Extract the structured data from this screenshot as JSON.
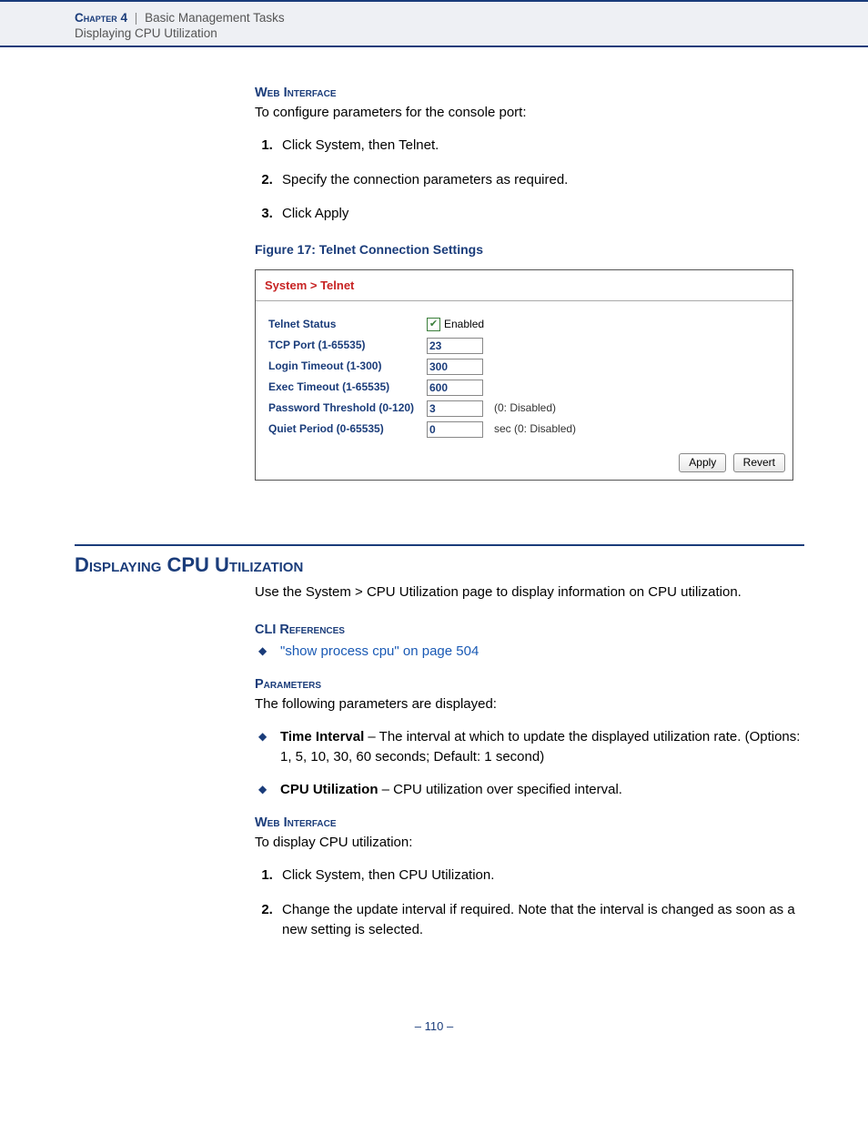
{
  "header": {
    "chapter_label": "Chapter 4",
    "separator": "|",
    "chapter_title": "Basic Management Tasks",
    "subtitle": "Displaying CPU Utilization"
  },
  "sec1": {
    "heading": "Web Interface",
    "intro": "To configure parameters for the console port:",
    "steps": [
      "Click System, then Telnet.",
      "Specify the connection parameters as required.",
      "Click Apply"
    ],
    "figure_caption": "Figure 17:  Telnet Connection Settings"
  },
  "figure": {
    "breadcrumb": "System > Telnet",
    "rows": {
      "telnet_status": {
        "label": "Telnet Status",
        "checkbox_label": "Enabled"
      },
      "tcp_port": {
        "label": "TCP Port (1-65535)",
        "value": "23"
      },
      "login_timeout": {
        "label": "Login Timeout (1-300)",
        "value": "300"
      },
      "exec_timeout": {
        "label": "Exec Timeout (1-65535)",
        "value": "600"
      },
      "pwd_threshold": {
        "label": "Password Threshold (0-120)",
        "value": "3",
        "hint": "(0: Disabled)"
      },
      "quiet_period": {
        "label": "Quiet Period (0-65535)",
        "value": "0",
        "hint": "sec (0: Disabled)"
      }
    },
    "buttons": {
      "apply": "Apply",
      "revert": "Revert"
    }
  },
  "section2": {
    "title": "Displaying CPU Utilization",
    "intro": "Use the System > CPU Utilization page to display information on CPU utilization.",
    "cli_heading": "CLI References",
    "cli_link": "\"show process cpu\" on page 504",
    "params_heading": "Parameters",
    "params_intro": "The following parameters are displayed:",
    "param_items": [
      {
        "name": "Time Interval",
        "desc": " – The interval at which to update the displayed utilization rate. (Options: 1, 5, 10, 30, 60 seconds; Default: 1 second)"
      },
      {
        "name": "CPU Utilization",
        "desc": " – CPU utilization over specified interval."
      }
    ],
    "web_heading": "Web Interface",
    "web_intro": "To display CPU utilization:",
    "web_steps": [
      "Click System, then CPU Utilization.",
      "Change the update interval if required. Note that the interval is changed as soon as a new setting is selected."
    ]
  },
  "footer": {
    "page_number": "–  110  –"
  }
}
